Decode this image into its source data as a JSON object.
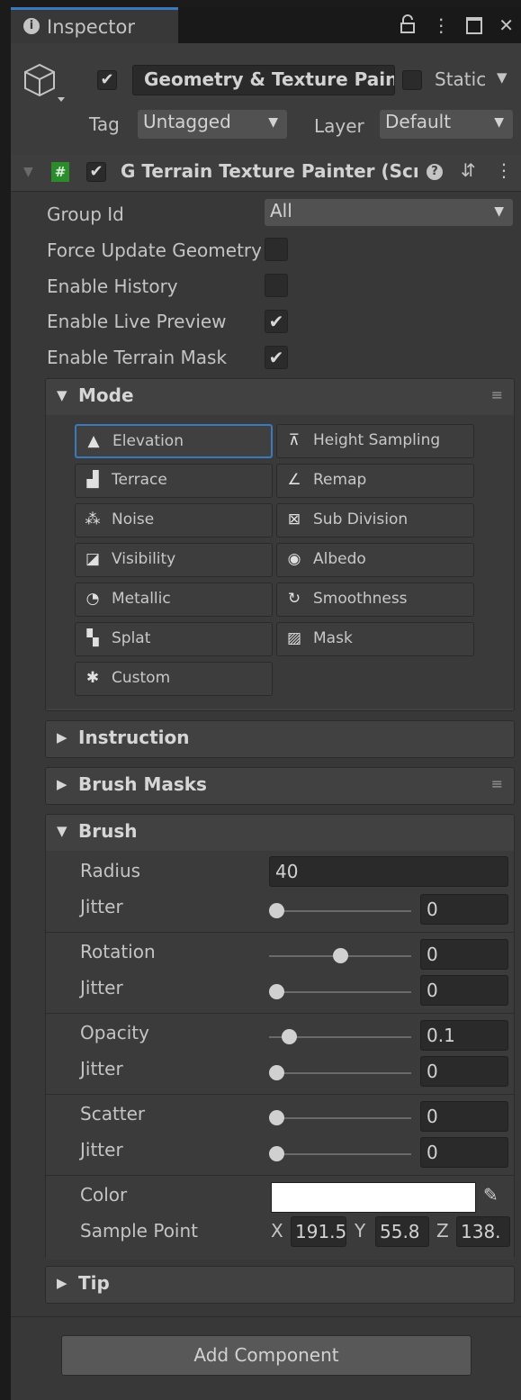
{
  "tab": {
    "icon": "info-icon",
    "title": "Inspector"
  },
  "window_controls": {
    "lock": "lock-icon",
    "menu": "kebab-menu-icon",
    "maximize": "maximize-icon",
    "close": "close-icon"
  },
  "header": {
    "enabled_check": "✔",
    "name": "Geometry & Texture Painter",
    "static_label": "Static",
    "tag_label": "Tag",
    "tag_value": "Untagged",
    "layer_label": "Layer",
    "layer_value": "Default"
  },
  "component": {
    "check": "✔",
    "title": "G Terrain Texture Painter (Script)"
  },
  "fields": {
    "group_id_label": "Group Id",
    "group_id_value": "All",
    "force_update_label": "Force Update Geometry",
    "force_update": false,
    "enable_history_label": "Enable History",
    "enable_history": false,
    "live_preview_label": "Enable Live Preview",
    "live_preview": true,
    "live_preview_mark": "✔",
    "terrain_mask_label": "Enable Terrain Mask",
    "terrain_mask": true,
    "terrain_mask_mark": "✔"
  },
  "mode": {
    "title": "Mode",
    "selected": "Elevation",
    "buttons": [
      {
        "label": "Elevation",
        "icon": "elevation-icon"
      },
      {
        "label": "Height Sampling",
        "icon": "height-sampling-icon"
      },
      {
        "label": "Terrace",
        "icon": "terrace-icon"
      },
      {
        "label": "Remap",
        "icon": "remap-icon"
      },
      {
        "label": "Noise",
        "icon": "noise-icon"
      },
      {
        "label": "Sub Division",
        "icon": "sub-division-icon"
      },
      {
        "label": "Visibility",
        "icon": "visibility-icon"
      },
      {
        "label": "Albedo",
        "icon": "albedo-icon"
      },
      {
        "label": "Metallic",
        "icon": "metallic-icon"
      },
      {
        "label": "Smoothness",
        "icon": "smoothness-icon"
      },
      {
        "label": "Splat",
        "icon": "splat-icon"
      },
      {
        "label": "Mask",
        "icon": "mask-icon"
      },
      {
        "label": "Custom",
        "icon": "gear-icon"
      }
    ]
  },
  "sections": {
    "instruction": "Instruction",
    "brush_masks": "Brush Masks",
    "brush": "Brush",
    "tip": "Tip"
  },
  "brush": {
    "radius_label": "Radius",
    "radius_value": "40",
    "radius_jitter_label": "Jitter",
    "radius_jitter_value": "0",
    "rotation_label": "Rotation",
    "rotation_value": "0",
    "rotation_slider": 0.5,
    "rotation_jitter_label": "Jitter",
    "rotation_jitter_value": "0",
    "opacity_label": "Opacity",
    "opacity_value": "0.1",
    "opacity_slider": 0.1,
    "opacity_jitter_label": "Jitter",
    "opacity_jitter_value": "0",
    "scatter_label": "Scatter",
    "scatter_value": "0",
    "scatter_jitter_label": "Jitter",
    "scatter_jitter_value": "0",
    "color_label": "Color",
    "color_value": "#ffffff",
    "sample_point_label": "Sample Point",
    "x_label": "X",
    "x_value": "191.5",
    "y_label": "Y",
    "y_value": "55.8",
    "z_label": "Z",
    "z_value": "138."
  },
  "add_component": "Add Component",
  "colors": {
    "accent": "#3a79bb",
    "script_icon": "#2c8c2c",
    "panel": "#383838"
  }
}
